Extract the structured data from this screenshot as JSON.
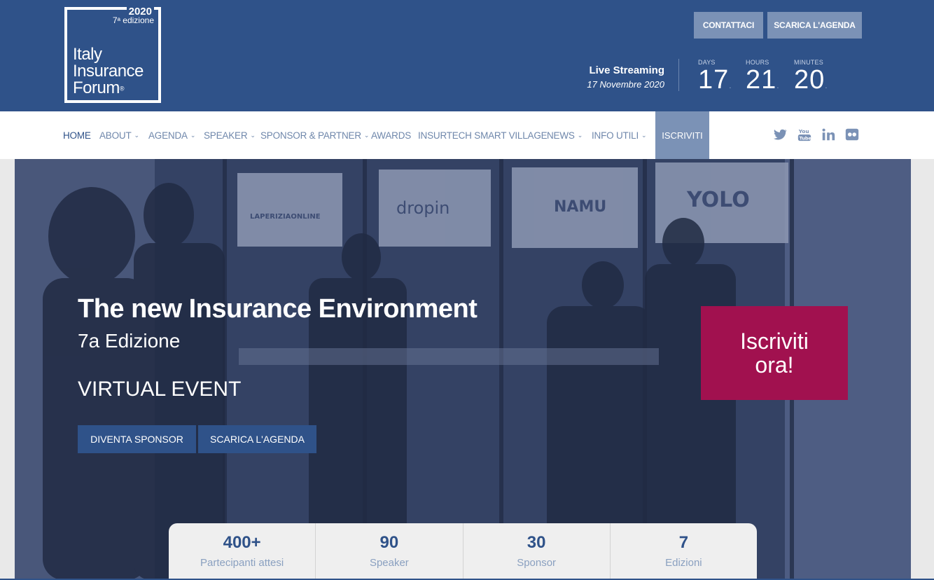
{
  "brand": {
    "logo_year": "2020",
    "logo_edition": "7ᵃ edizione",
    "logo_line1": "Italy",
    "logo_line2": "Insurance",
    "logo_line3": "Forum",
    "logo_reg": "®"
  },
  "header": {
    "contact_label": "CONTATTACI",
    "agenda_label": "SCARICA L'AGENDA",
    "live_title": "Live Streaming",
    "live_date": "17 Novembre 2020",
    "countdown": {
      "days_label": "DAYS",
      "days": "17",
      "hours_label": "HOURS",
      "hours": "21",
      "minutes_label": "MINUTES",
      "minutes": "20"
    }
  },
  "nav": {
    "items": [
      {
        "label": "HOME"
      },
      {
        "label": "ABOUT"
      },
      {
        "label": "AGENDA"
      },
      {
        "label": "SPEAKER"
      },
      {
        "label": "SPONSOR & PARTNER"
      },
      {
        "label": "AWARDS"
      },
      {
        "label": "INSURTECH SMART VILLAGE"
      },
      {
        "label": "NEWS"
      },
      {
        "label": "INFO UTILI"
      }
    ],
    "cta": "ISCRIVITI",
    "social": [
      "twitter-icon",
      "youtube-icon",
      "linkedin-icon",
      "flickr-icon"
    ]
  },
  "hero": {
    "title": "The new Insurance Environment",
    "subtitle": "7a Edizione",
    "event_type": "VIRTUAL EVENT",
    "sponsor_btn": "DIVENTA SPONSOR",
    "agenda_btn": "SCARICA L'AGENDA",
    "cta_line1": "Iscriviti",
    "cta_line2": "ora!",
    "booth_signs": [
      "LAPERIZIAONLINE",
      "dropin",
      "NAMU",
      "YOLO"
    ]
  },
  "stats": [
    {
      "value": "400+",
      "label": "Partecipanti attesi"
    },
    {
      "value": "90",
      "label": "Speaker"
    },
    {
      "value": "30",
      "label": "Sponsor"
    },
    {
      "value": "7",
      "label": "Edizioni"
    }
  ],
  "colors": {
    "primary": "#2f5289",
    "accent": "#a1114f",
    "muted_button": "#7b92b6"
  }
}
